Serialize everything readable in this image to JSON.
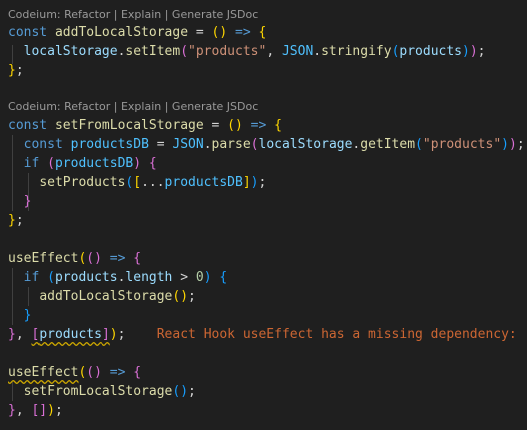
{
  "codelens": {
    "first": "Codeium: Refactor | Explain | Generate JSDoc",
    "second": "Codeium: Refactor | Explain | Generate JSDoc"
  },
  "code": {
    "line1": {
      "const": "const",
      "name": "addToLocalStorage",
      "eq": " = ",
      "open": "()",
      "arrow": " => ",
      "brace": "{"
    },
    "line2": {
      "obj": "localStorage",
      "dot": ".",
      "method": "setItem",
      "open": "(",
      "key": "\"products\"",
      "comma": ", ",
      "json": "JSON",
      "dot2": ".",
      "stringify": "stringify",
      "open2": "(",
      "arg": "products",
      "close2": ")",
      "close": ")",
      "semi": ";"
    },
    "line3": {
      "brace": "}",
      "semi": ";"
    },
    "line5": {
      "const": "const",
      "name": "setFromLocalStorage",
      "eq": " = ",
      "open": "()",
      "arrow": " => ",
      "brace": "{"
    },
    "line6": {
      "const": "const",
      "var": "productsDB",
      "eq": " = ",
      "json": "JSON",
      "dot": ".",
      "parse": "parse",
      "open": "(",
      "obj": "localStorage",
      "dot2": ".",
      "getItem": "getItem",
      "open2": "(",
      "key": "\"products\"",
      "close2": ")",
      "close": ")",
      "semi": ";"
    },
    "line7": {
      "if": "if",
      "open": "(",
      "var": "productsDB",
      "close": ")",
      "brace": "{"
    },
    "line8": {
      "fn": "setProducts",
      "open": "(",
      "bracket": "[",
      "spread": "...",
      "var": "productsDB",
      "bclose": "]",
      "close": ")",
      "semi": ";"
    },
    "line9": {
      "brace": "}"
    },
    "line10": {
      "brace": "}",
      "semi": ";"
    },
    "line12": {
      "fn": "useEffect",
      "open": "(",
      "args": "()",
      "arrow": " => ",
      "brace": "{"
    },
    "line13": {
      "if": "if",
      "open": "(",
      "obj": "products",
      "dot": ".",
      "prop": "length",
      "op": " > ",
      "num": "0",
      "close": ")",
      "brace": "{"
    },
    "line14": {
      "fn": "addToLocalStorage",
      "call": "()",
      "semi": ";"
    },
    "line15": {
      "brace": "}"
    },
    "line16": {
      "brace": "}",
      "comma": ", ",
      "bopen": "[",
      "var": "products",
      "bclose": "]",
      "close": ")",
      "semi": ";"
    },
    "line18": {
      "fn": "useEffect",
      "open": "(",
      "args": "()",
      "arrow": " => ",
      "brace": "{"
    },
    "line19": {
      "fn": "setFromLocalStorage",
      "call": "()",
      "semi": ";"
    },
    "line20": {
      "brace": "}",
      "comma": ", ",
      "arr": "[]",
      "close": ")",
      "semi": ";"
    }
  },
  "diagnostic": {
    "message": "React Hook useEffect has a missing dependency: 'a"
  },
  "colors": {
    "background": "#1f1f1f",
    "keyword": "#569cd6",
    "function": "#dcdcaa",
    "variable": "#9cdcfe",
    "string": "#ce9178",
    "warning": "#cc6633"
  }
}
